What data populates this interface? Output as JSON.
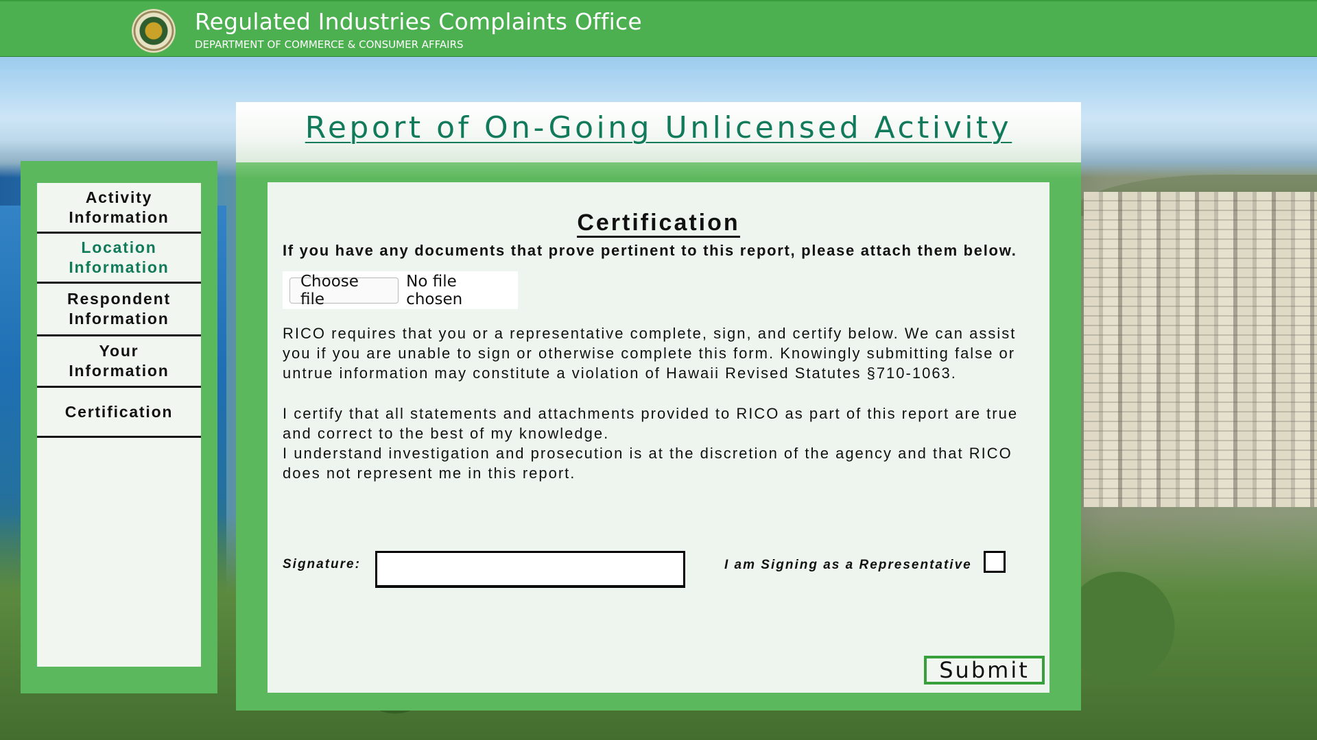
{
  "header": {
    "title": "Regulated Industries Complaints Office",
    "subtitle": "DEPARTMENT OF COMMERCE & CONSUMER AFFAIRS",
    "seal_icon": "state-seal-icon"
  },
  "sidebar": {
    "items": [
      {
        "label": "Activity\nInformation",
        "active": false
      },
      {
        "label": "Location\nInformation",
        "active": true
      },
      {
        "label": "Respondent\nInformation",
        "active": false
      },
      {
        "label": "Your\nInformation",
        "active": false
      },
      {
        "label": "Certification",
        "active": false
      }
    ]
  },
  "page": {
    "title": "Report of On-Going Unlicensed Activity"
  },
  "certification": {
    "heading": "Certification",
    "attach_instruction": "If you have any documents that prove pertinent to this report, please attach them below.",
    "file_button": "Choose file",
    "file_status": "No file chosen",
    "paragraph_1": "RICO requires that you or a representative complete, sign, and certify below. We can assist you if you are unable to sign or otherwise complete this form. Knowingly submitting false or untrue information may constitute a violation of Hawaii Revised Statutes §710-1063.",
    "paragraph_2": "I certify that all statements and attachments provided to RICO as part of this report are true and correct to the best of my knowledge.",
    "paragraph_3": "I understand investigation and prosecution is at the discretion of the agency and that RICO does not represent me in this report.",
    "signature_label": "Signature:",
    "signature_value": "",
    "representative_label": "I am Signing as a Representative",
    "representative_checked": false,
    "submit_label": "Submit"
  },
  "colors": {
    "brand_green": "#4caf50",
    "panel_green": "#5cb85c",
    "accent_teal": "#117a5a"
  }
}
